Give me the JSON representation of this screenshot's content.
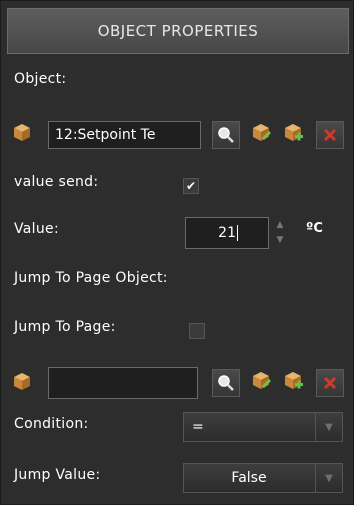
{
  "header": {
    "title": "OBJECT PROPERTIES"
  },
  "object": {
    "label": "Object:",
    "value": "12:Setpoint Te"
  },
  "value_send": {
    "label": "value send:",
    "checked_glyph": "✔"
  },
  "value": {
    "label": "Value:",
    "current": "21",
    "unit": "ºC"
  },
  "jump_to_page_object": {
    "label": "Jump To Page Object:"
  },
  "jump_to_page": {
    "label": "Jump To Page:"
  },
  "jump_object": {
    "value": ""
  },
  "condition": {
    "label": "Condition:",
    "selected": "="
  },
  "jump_value": {
    "label": "Jump Value:",
    "selected": "False"
  },
  "colors": {
    "delete": "#c0392b",
    "panel": "#2d2d2d",
    "header": "#505050"
  }
}
